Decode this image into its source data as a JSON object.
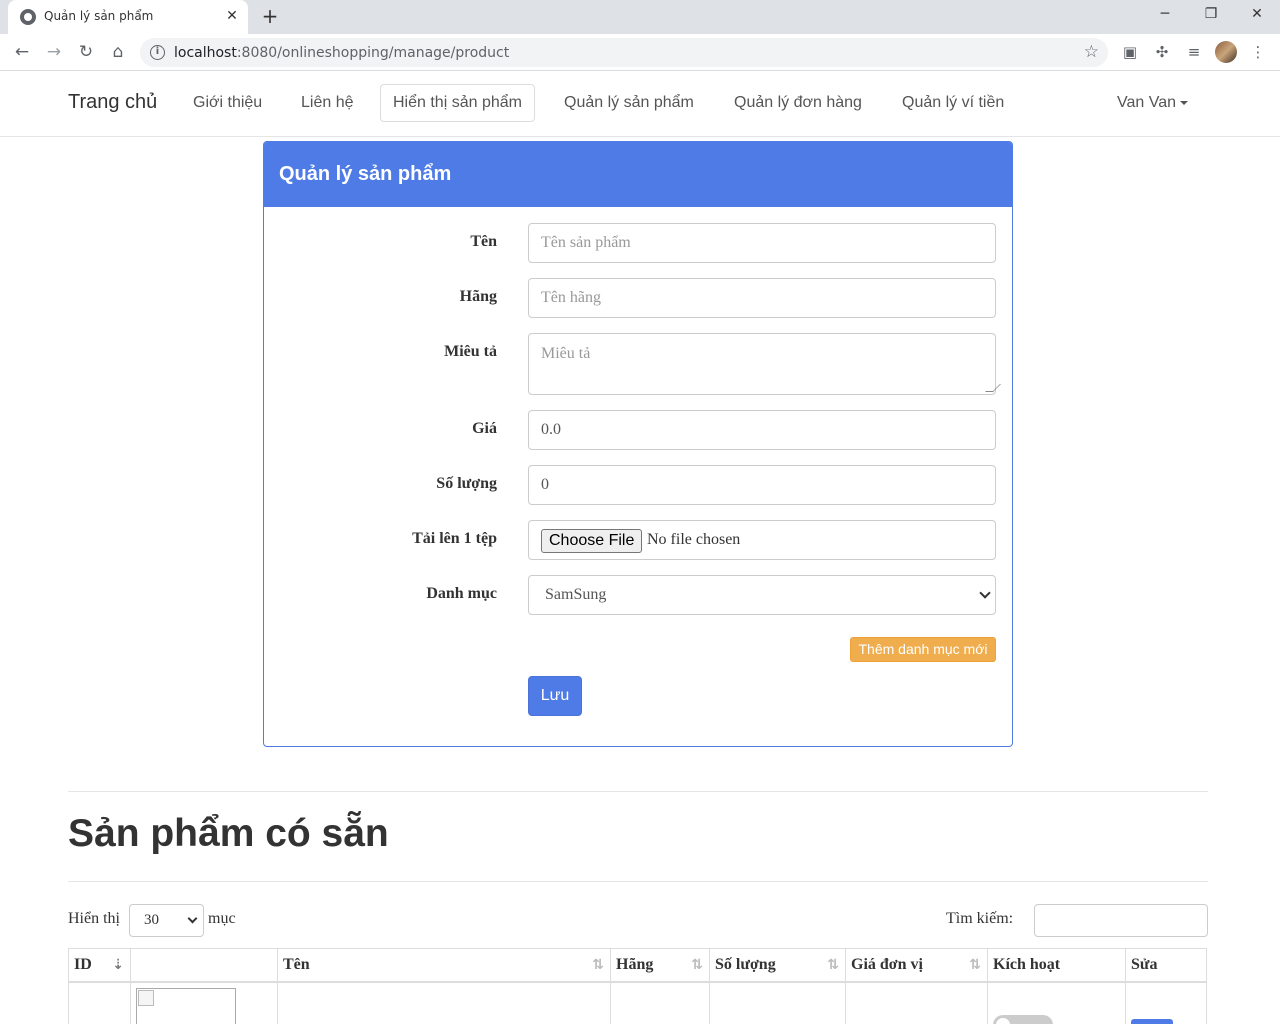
{
  "browser": {
    "tab_title": "Quản lý sản phẩm",
    "url_host": "localhost",
    "url_path": ":8080/onlineshopping/manage/product"
  },
  "navbar": {
    "brand": "Trang chủ",
    "links": [
      "Giới thiệu",
      "Liên hệ",
      "Hiển thị sản phẩm",
      "Quản lý sản phẩm",
      "Quản lý đơn hàng",
      "Quản lý ví tiền"
    ],
    "active_link": "Hiển thị sản phẩm",
    "user": "Van Van"
  },
  "form": {
    "title": "Quản lý sản phẩm",
    "name_label": "Tên",
    "name_placeholder": "Tên sản phẩm",
    "brand_label": "Hãng",
    "brand_placeholder": "Tên hãng",
    "description_label": "Miêu tả",
    "description_placeholder": "Miêu tả",
    "price_label": "Giá",
    "price_value": "0.0",
    "quantity_label": "Số lượng",
    "quantity_value": "0",
    "file_label": "Tải lên 1 tệp",
    "file_button": "Choose File",
    "file_status": "No file chosen",
    "category_label": "Danh mục",
    "category_value": "SamSung",
    "add_category_button": "Thêm danh mục mới",
    "save_button": "Lưu"
  },
  "listing": {
    "title": "Sản phẩm có sẵn",
    "show_label": "Hiển thị",
    "page_length": "30",
    "entries_label": "mục",
    "search_label": "Tìm kiếm:",
    "columns": [
      "ID",
      "",
      "Tên",
      "Hãng",
      "Số lượng",
      "Giá đơn vị",
      "Kích hoạt",
      "Sửa"
    ]
  },
  "colors": {
    "primary": "#4f7be6",
    "warning": "#f0ad4e"
  }
}
